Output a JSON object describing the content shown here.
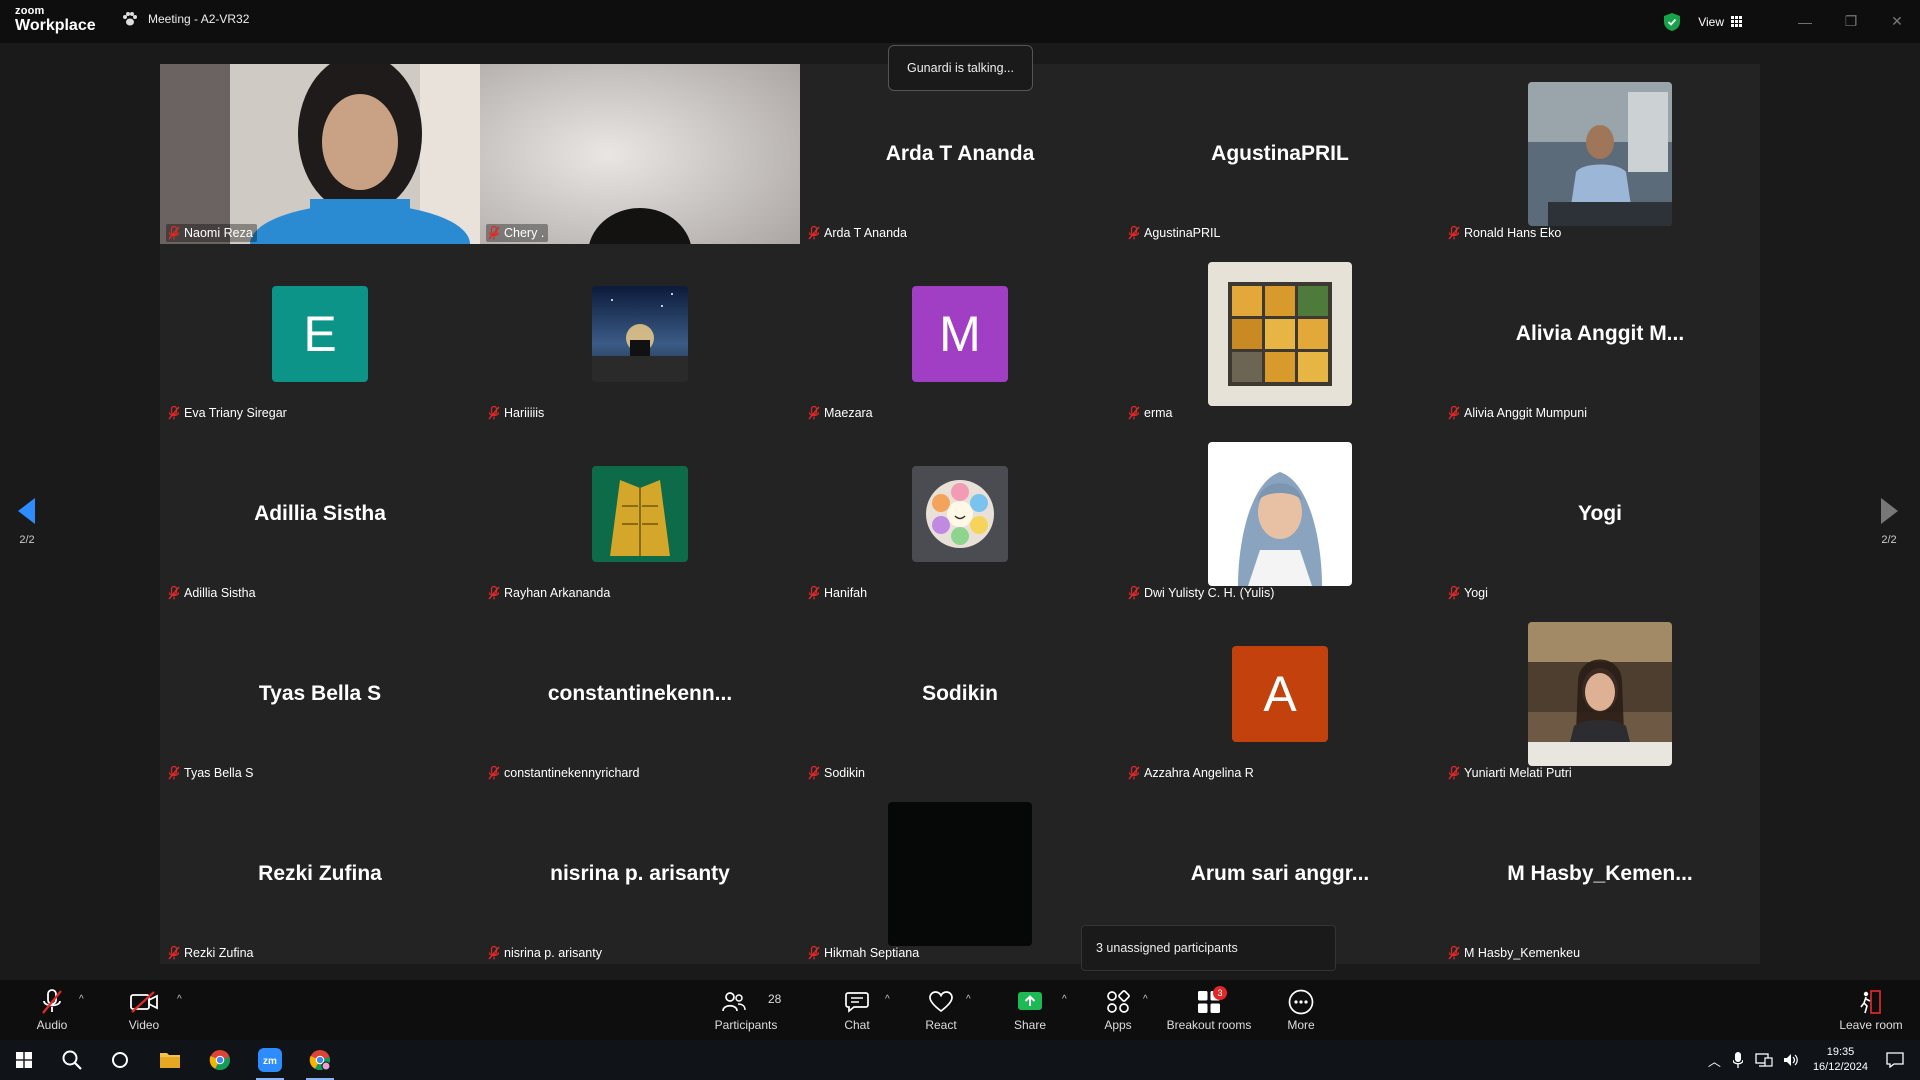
{
  "app": {
    "logo_small": "zoom",
    "logo_large": "Workplace",
    "meeting_title": "Meeting - A2-VR32",
    "view_label": "View",
    "win_minimize": "—",
    "win_restore": "❐",
    "win_close": "✕"
  },
  "talking_indicator": "Gunardi is talking...",
  "pagination": {
    "left": "2/2",
    "right": "2/2"
  },
  "participants": [
    {
      "label": "Naomi Reza",
      "kind": "video",
      "video": "woman"
    },
    {
      "label": "Chery .",
      "kind": "video",
      "video": "wall"
    },
    {
      "label": "Arda T Ananda",
      "kind": "name",
      "big": "Arda T Ananda"
    },
    {
      "label": "AgustinaPRIL",
      "kind": "name",
      "big": "AgustinaPRIL"
    },
    {
      "label": "Ronald Hans Eko",
      "kind": "photo",
      "photo": "office"
    },
    {
      "label": "Eva Triany Siregar",
      "kind": "letter",
      "letter": "E",
      "color": "#0d9488"
    },
    {
      "label": "Hariiiiis",
      "kind": "photo",
      "photo": "night"
    },
    {
      "label": "Maezara",
      "kind": "letter",
      "letter": "M",
      "color": "#a03fc4"
    },
    {
      "label": "erma",
      "kind": "photo",
      "photo": "window"
    },
    {
      "label": "Alivia Anggit Mumpuni",
      "kind": "name",
      "big": "Alivia Anggit M..."
    },
    {
      "label": "Adillia Sistha",
      "kind": "name",
      "big": "Adillia Sistha"
    },
    {
      "label": "Rayhan Arkananda",
      "kind": "photo",
      "photo": "batik"
    },
    {
      "label": "Hanifah",
      "kind": "photo",
      "photo": "flower"
    },
    {
      "label": "Dwi Yulisty C. H. (Yulis)",
      "kind": "photo",
      "photo": "hijab"
    },
    {
      "label": "Yogi",
      "kind": "name",
      "big": "Yogi"
    },
    {
      "label": "Tyas Bella S",
      "kind": "name",
      "big": "Tyas Bella S"
    },
    {
      "label": "constantinekennyrichard",
      "kind": "name",
      "big": "constantinekenn..."
    },
    {
      "label": "Sodikin",
      "kind": "name",
      "big": "Sodikin"
    },
    {
      "label": "Azzahra Angelina R",
      "kind": "letter",
      "letter": "A",
      "color": "#c2410c"
    },
    {
      "label": "Yuniarti Melati Putri",
      "kind": "photo",
      "photo": "woman2"
    },
    {
      "label": "Rezki Zufina",
      "kind": "name",
      "big": "Rezki Zufina"
    },
    {
      "label": "nisrina p. arisanty",
      "kind": "name",
      "big": "nisrina p. arisanty"
    },
    {
      "label": "Hikmah Septiana",
      "kind": "photo",
      "photo": "black"
    },
    {
      "label": "",
      "kind": "name",
      "big": "Arum sari anggr..."
    },
    {
      "label": "M Hasby_Kemenkeu",
      "kind": "name",
      "big": "M  Hasby_Kemen..."
    }
  ],
  "unassigned_popup": "3 unassigned participants",
  "toolbar": {
    "audio": "Audio",
    "video": "Video",
    "participants": "Participants",
    "participants_count": "28",
    "chat": "Chat",
    "react": "React",
    "share": "Share",
    "apps": "Apps",
    "breakout": "Breakout rooms",
    "breakout_badge": "3",
    "more": "More",
    "leave": "Leave room"
  },
  "taskbar": {
    "time": "19:35",
    "date": "16/12/2024"
  },
  "colors": {
    "accent_blue": "#2d8cff",
    "share_green": "#1db954",
    "mic_off_red": "#e02828",
    "shield_green": "#16a34a"
  }
}
